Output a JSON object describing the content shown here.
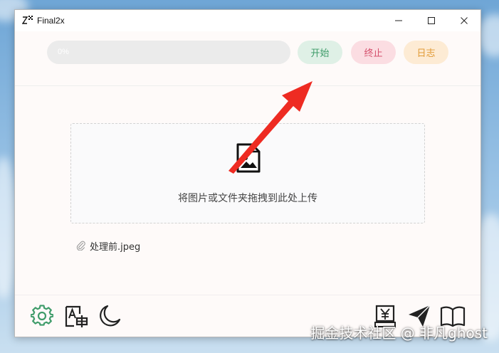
{
  "window": {
    "title": "Final2x"
  },
  "toolbar": {
    "progress_percent": 0,
    "progress_label": "0%",
    "start_label": "开始",
    "stop_label": "终止",
    "log_label": "日志"
  },
  "dropzone": {
    "hint": "将图片或文件夹拖拽到此处上传"
  },
  "files": [
    {
      "name": "处理前.jpeg"
    }
  ],
  "bottom_bar": {
    "left_icons": [
      "gear-icon",
      "translate-icon",
      "moon-icon"
    ],
    "right_icons": [
      "yen-box-icon",
      "paper-plane-icon",
      "open-book-icon"
    ]
  },
  "watermark": "掘金技术社区 @ 非凡ghost",
  "colors": {
    "start_bg": "#dff0e6",
    "start_fg": "#3f9c6a",
    "stop_bg": "#fbdde2",
    "stop_fg": "#d4506c",
    "log_bg": "#fdebd4",
    "log_fg": "#e19a35",
    "settings_icon": "#3f9c6a",
    "annotation_arrow": "#ee2b22"
  }
}
